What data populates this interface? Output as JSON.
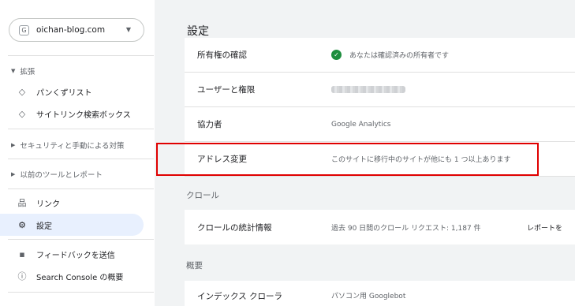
{
  "sidebar": {
    "property": {
      "site": "oichan-blog.com"
    },
    "sections": {
      "extensions": "拡張",
      "security": "セキュリティと手動による対策",
      "legacy": "以前のツールとレポート"
    },
    "items": {
      "breadcrumbs": "パンくずリスト",
      "sitelinks": "サイトリンク検索ボックス",
      "links": "リンク",
      "settings": "設定",
      "feedback": "フィードバックを送信",
      "about": "Search Console の概要"
    }
  },
  "main": {
    "title": "設定",
    "rows": {
      "ownership": {
        "label": "所有権の確認",
        "value": "あなたは確認済みの所有者です"
      },
      "users": {
        "label": "ユーザーと権限"
      },
      "associations": {
        "label": "協力者",
        "value": "Google Analytics"
      },
      "change_address": {
        "label": "アドレス変更",
        "value": "このサイトに移行中のサイトが他にも 1 つ以上あります"
      }
    },
    "crawl_heading": "クロール",
    "crawl_stats": {
      "label": "クロールの統計情報",
      "value": "過去 90 日間のクロール リクエスト: 1,187 件",
      "link": "レポートを"
    },
    "overview_heading": "概要",
    "index_row": {
      "label": "インデックス クローラ",
      "value": "パソコン用 Googlebot"
    }
  },
  "colors": {
    "accent": "#e8f0fe",
    "check": "#1e8e3e",
    "highlight": "#e00000"
  }
}
